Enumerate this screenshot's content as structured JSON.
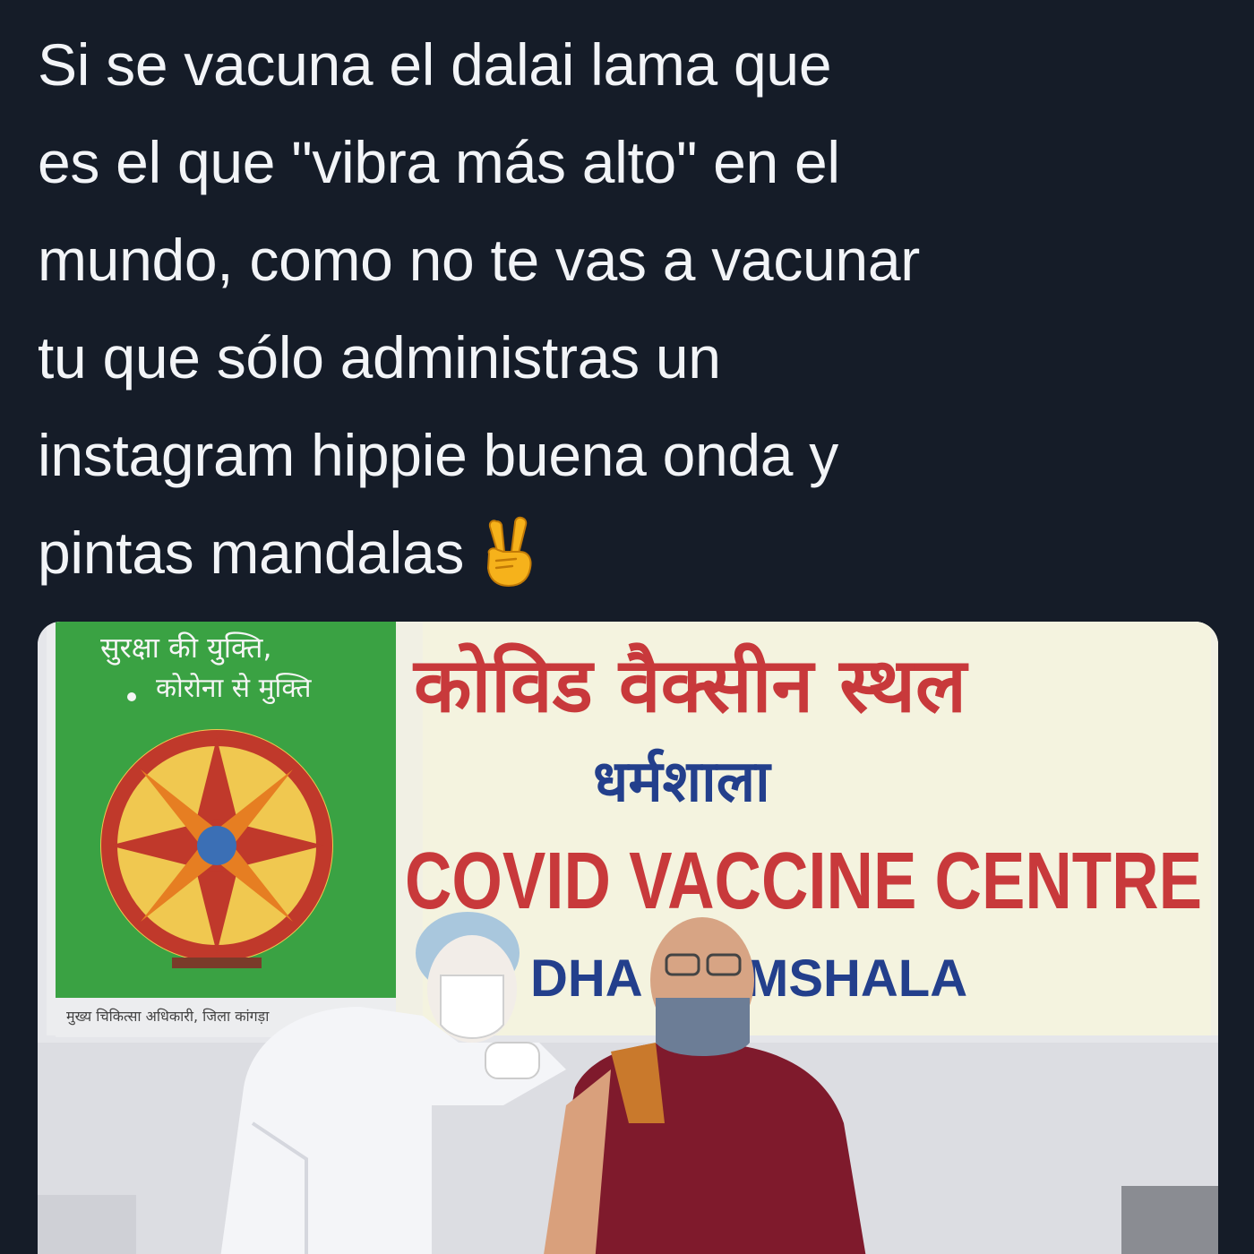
{
  "tweet": {
    "lines": [
      "Si se vacuna el dalai lama que",
      "es el que \"vibra más alto\" en el",
      "mundo, como no te vas a vacunar",
      "tu que sólo administras un",
      "instagram hippie buena onda y",
      "pintas mandalas"
    ],
    "emoji": "victory-hand-icon"
  },
  "photo": {
    "green_poster": {
      "line1": "सुरक्षा की युक्ति,",
      "line2": "कोरोना से मुक्ति",
      "footer": "मुख्य चिकित्सा अधिकारी, जिला कांगड़ा"
    },
    "banner": {
      "hindi_title": "कोविड वैक्सीन स्थल",
      "hindi_city": "धर्मशाला",
      "english_title": "COVID VACCINE CENTRE",
      "english_city_left": "DHA",
      "english_city_right": "MSHALA"
    }
  },
  "colors": {
    "background": "#151c28",
    "text": "#f2f4f7",
    "banner_red": "#c8393b",
    "banner_blue": "#233f8c",
    "poster_green": "#3aa243",
    "robe": "#7f1a2c"
  }
}
